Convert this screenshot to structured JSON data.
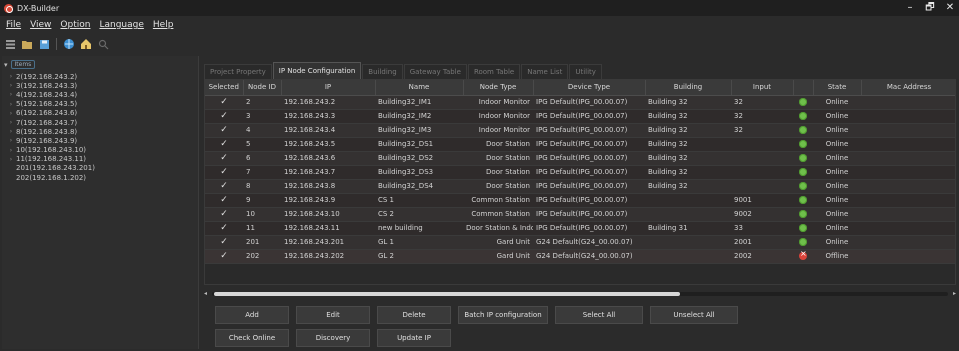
{
  "window": {
    "title": "DX-Builder",
    "controls": [
      "–",
      "🗗",
      "✕"
    ]
  },
  "menu": [
    {
      "label": "File"
    },
    {
      "label": "View"
    },
    {
      "label": "Option"
    },
    {
      "label": "Language"
    },
    {
      "label": "Help"
    }
  ],
  "toolbar": {
    "icons": [
      "list-icon",
      "folder-icon",
      "save-icon",
      "network-icon",
      "home-icon",
      "search-icon"
    ]
  },
  "tree": {
    "root_label": "Items",
    "nodes": [
      {
        "label": "2(192.168.243.2)",
        "expandable": true
      },
      {
        "label": "3(192.168.243.3)",
        "expandable": true
      },
      {
        "label": "4(192.168.243.4)",
        "expandable": true
      },
      {
        "label": "5(192.168.243.5)",
        "expandable": true
      },
      {
        "label": "6(192.168.243.6)",
        "expandable": true
      },
      {
        "label": "7(192.168.243.7)",
        "expandable": true
      },
      {
        "label": "8(192.168.243.8)",
        "expandable": true
      },
      {
        "label": "9(192.168.243.9)",
        "expandable": true
      },
      {
        "label": "10(192.168.243.10)",
        "expandable": true
      },
      {
        "label": "11(192.168.243.11)",
        "expandable": true
      },
      {
        "label": "201(192.168.243.201)",
        "expandable": false
      },
      {
        "label": "202(192.168.1.202)",
        "expandable": false
      }
    ]
  },
  "tabs": [
    {
      "label": "Project Property",
      "active": false
    },
    {
      "label": "IP Node Configuration",
      "active": true
    },
    {
      "label": "Building",
      "active": false
    },
    {
      "label": "Gateway Table",
      "active": false
    },
    {
      "label": "Room Table",
      "active": false
    },
    {
      "label": "Name List",
      "active": false
    },
    {
      "label": "Utility",
      "active": false
    }
  ],
  "grid": {
    "columns": [
      "Selected",
      "Node ID",
      "IP",
      "Name",
      "Node Type",
      "Device Type",
      "Building",
      "Input",
      "",
      "State",
      "Mac Address"
    ],
    "rows": [
      {
        "selected": "✓",
        "node_id": "2",
        "ip": "192.168.243.2",
        "name": "Building32_IM1",
        "node_type": "Indoor Monitor",
        "device_type": "IPG Default(IPG_00.00.07)",
        "building": "Building 32",
        "input": "32",
        "state": "Online",
        "status": "online",
        "mac": ""
      },
      {
        "selected": "✓",
        "node_id": "3",
        "ip": "192.168.243.3",
        "name": "Building32_IM2",
        "node_type": "Indoor Monitor",
        "device_type": "IPG Default(IPG_00.00.07)",
        "building": "Building 32",
        "input": "32",
        "state": "Online",
        "status": "online",
        "mac": ""
      },
      {
        "selected": "✓",
        "node_id": "4",
        "ip": "192.168.243.4",
        "name": "Building32_IM3",
        "node_type": "Indoor Monitor",
        "device_type": "IPG Default(IPG_00.00.07)",
        "building": "Building 32",
        "input": "32",
        "state": "Online",
        "status": "online",
        "mac": ""
      },
      {
        "selected": "✓",
        "node_id": "5",
        "ip": "192.168.243.5",
        "name": "Building32_DS1",
        "node_type": "Door Station",
        "device_type": "IPG Default(IPG_00.00.07)",
        "building": "Building 32",
        "input": "",
        "state": "Online",
        "status": "online",
        "mac": ""
      },
      {
        "selected": "✓",
        "node_id": "6",
        "ip": "192.168.243.6",
        "name": "Building32_DS2",
        "node_type": "Door Station",
        "device_type": "IPG Default(IPG_00.00.07)",
        "building": "Building 32",
        "input": "",
        "state": "Online",
        "status": "online",
        "mac": ""
      },
      {
        "selected": "✓",
        "node_id": "7",
        "ip": "192.168.243.7",
        "name": "Building32_DS3",
        "node_type": "Door Station",
        "device_type": "IPG Default(IPG_00.00.07)",
        "building": "Building 32",
        "input": "",
        "state": "Online",
        "status": "online",
        "mac": ""
      },
      {
        "selected": "✓",
        "node_id": "8",
        "ip": "192.168.243.8",
        "name": "Building32_DS4",
        "node_type": "Door Station",
        "device_type": "IPG Default(IPG_00.00.07)",
        "building": "Building 32",
        "input": "",
        "state": "Online",
        "status": "online",
        "mac": ""
      },
      {
        "selected": "✓",
        "node_id": "9",
        "ip": "192.168.243.9",
        "name": "CS 1",
        "node_type": "Common Station",
        "device_type": "IPG Default(IPG_00.00.07)",
        "building": "",
        "input": "9001",
        "state": "Online",
        "status": "online",
        "mac": ""
      },
      {
        "selected": "✓",
        "node_id": "10",
        "ip": "192.168.243.10",
        "name": "CS 2",
        "node_type": "Common Station",
        "device_type": "IPG Default(IPG_00.00.07)",
        "building": "",
        "input": "9002",
        "state": "Online",
        "status": "online",
        "mac": ""
      },
      {
        "selected": "✓",
        "node_id": "11",
        "ip": "192.168.243.11",
        "name": "new building",
        "node_type": "Door Station & Indo",
        "device_type": "IPG Default(IPG_00.00.07)",
        "building": "Building 31",
        "input": "33",
        "state": "Online",
        "status": "online",
        "mac": ""
      },
      {
        "selected": "✓",
        "node_id": "201",
        "ip": "192.168.243.201",
        "name": "GL 1",
        "node_type": "Gard Unit",
        "device_type": "G24 Default(G24_00.00.07)",
        "building": "",
        "input": "2001",
        "state": "Online",
        "status": "online",
        "mac": ""
      },
      {
        "selected": "✓",
        "node_id": "202",
        "ip": "192.168.243.202",
        "name": "GL 2",
        "node_type": "Gard Unit",
        "device_type": "G24 Default(G24_00.00.07)",
        "building": "",
        "input": "2002",
        "state": "Offline",
        "status": "offline",
        "mac": ""
      }
    ]
  },
  "buttons": {
    "add": "Add",
    "edit": "Edit",
    "delete": "Delete",
    "batch_ip": "Batch IP configuration",
    "select_all": "Select All",
    "unselect_all": "Unselect All",
    "check_online": "Check Online",
    "discovery": "Discovery",
    "update_ip": "Update IP"
  }
}
